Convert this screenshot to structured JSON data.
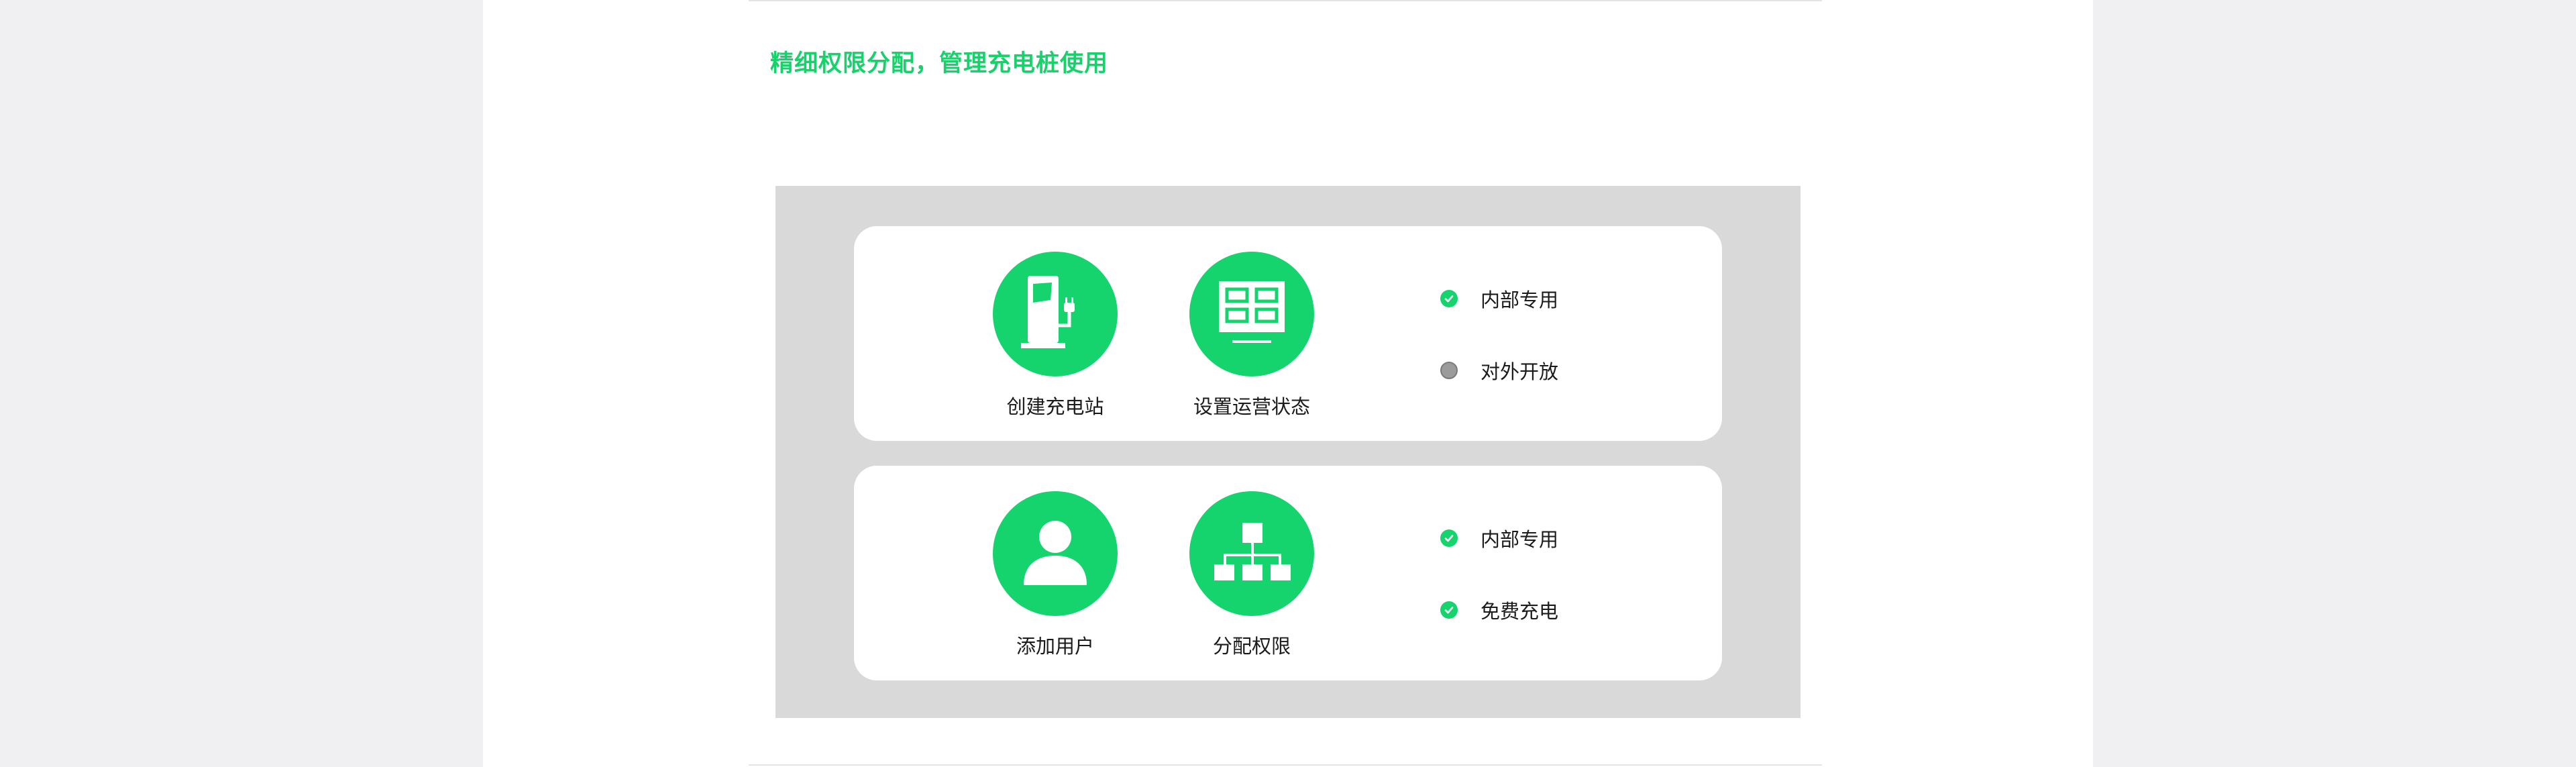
{
  "headline": "精细权限分配，管理充电桩使用",
  "colors": {
    "accent": "#15d46d",
    "headline": "#17d26b",
    "panel_bg": "#d9d9d9",
    "unchecked": "#9b9b9b"
  },
  "cards": [
    {
      "features": [
        {
          "label": "创建充电站",
          "icon": "charging-station-icon"
        },
        {
          "label": "设置运营状态",
          "icon": "status-panel-icon"
        }
      ],
      "options": [
        {
          "label": "内部专用",
          "checked": true
        },
        {
          "label": "对外开放",
          "checked": false
        }
      ]
    },
    {
      "features": [
        {
          "label": "添加用户",
          "icon": "user-icon"
        },
        {
          "label": "分配权限",
          "icon": "org-chart-icon"
        }
      ],
      "options": [
        {
          "label": "内部专用",
          "checked": true
        },
        {
          "label": "免费充电",
          "checked": true
        }
      ]
    }
  ]
}
